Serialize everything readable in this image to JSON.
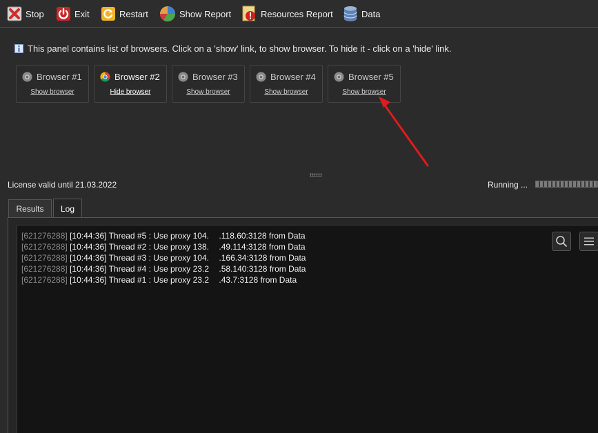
{
  "toolbar": {
    "stop": "Stop",
    "exit": "Exit",
    "restart": "Restart",
    "show_report": "Show Report",
    "resources_report": "Resources Report",
    "data": "Data"
  },
  "info": {
    "text": "This panel contains list of browsers. Click on a 'show' link, to show browser. To hide it - click on a 'hide' link."
  },
  "browsers": [
    {
      "title": "Browser #1",
      "link": "Show browser",
      "active": false
    },
    {
      "title": "Browser #2",
      "link": "Hide browser",
      "active": true
    },
    {
      "title": "Browser #3",
      "link": "Show browser",
      "active": false
    },
    {
      "title": "Browser #4",
      "link": "Show browser",
      "active": false
    },
    {
      "title": "Browser #5",
      "link": "Show browser",
      "active": false
    }
  ],
  "status": {
    "license": "License valid until 21.03.2022",
    "running": "Running ..."
  },
  "tabs": {
    "results": "Results",
    "log": "Log",
    "active": "Log"
  },
  "log": {
    "lines": [
      {
        "id": "[621276288]",
        "text": "[10:44:36] Thread #5 : Use proxy 104.      .118.60:3128 from Data"
      },
      {
        "id": "[621276288]",
        "text": "[10:44:36] Thread #2 : Use proxy 138.      .49.114:3128 from Data"
      },
      {
        "id": "[621276288]",
        "text": "[10:44:36] Thread #3 : Use proxy 104.      .166.34:3128 from Data"
      },
      {
        "id": "[621276288]",
        "text": "[10:44:36] Thread #4 : Use proxy 23.2      .58.140:3128 from Data"
      },
      {
        "id": "[621276288]",
        "text": "[10:44:36] Thread #1 : Use proxy 23.2      .43.7:3128 from Data"
      }
    ]
  },
  "icons": {
    "stop": "stop-icon",
    "exit": "power-icon",
    "restart": "restart-icon",
    "show_report": "pie-chart-icon",
    "resources_report": "warning-icon",
    "data": "database-icon",
    "info": "info-icon",
    "browser": "browser-icon",
    "search": "search-icon",
    "menu": "menu-icon"
  },
  "colors": {
    "background": "#2b2b2b",
    "log_background": "#141414",
    "annotation_arrow": "#e01b1b"
  }
}
